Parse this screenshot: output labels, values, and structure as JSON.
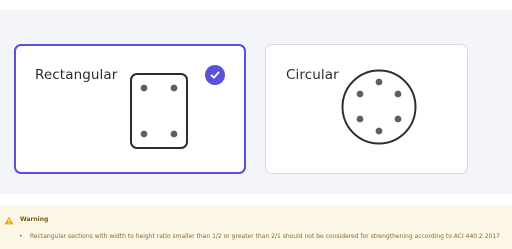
{
  "section_options": [
    {
      "label": "Rectangular",
      "selected": true
    },
    {
      "label": "Circular",
      "selected": false
    }
  ],
  "icons": {
    "selected_check": "check-circle-icon",
    "rectangular_shape": "rectangular-section-icon",
    "circular_shape": "circular-section-icon",
    "warning": "warning-triangle-icon"
  },
  "warning": {
    "title": "Warning",
    "bullet": "•",
    "message": "Rectangular sections with width to height ratio smaller than 1/2 or greater than 2/1 should not be considered for strengthening according to ACI 440.2 2017"
  },
  "colors": {
    "accent": "#5a51d9",
    "warning_background": "#fdf7e7",
    "warning_icon": "#e6a817"
  }
}
